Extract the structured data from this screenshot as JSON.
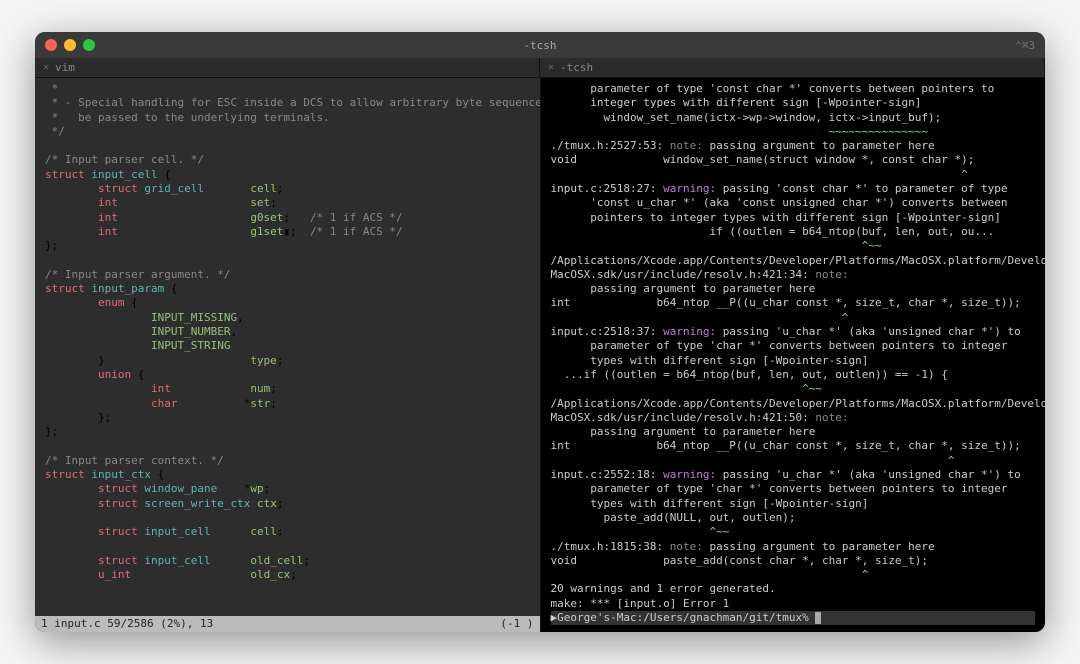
{
  "titlebar": {
    "title": "-tcsh",
    "rightBadge": "⌃⌘3"
  },
  "tabs": {
    "left": "vim",
    "right": "-tcsh"
  },
  "left": {
    "lines": [
      [
        {
          "cls": "c-comment",
          "t": " *"
        }
      ],
      [
        {
          "cls": "c-comment",
          "t": " * - Special handling for ESC inside a DCS to allow arbitrary byte sequences to"
        }
      ],
      [
        {
          "cls": "c-comment",
          "t": " *   be passed to the underlying terminals."
        }
      ],
      [
        {
          "cls": "c-comment",
          "t": " */"
        }
      ],
      [
        {
          "t": ""
        }
      ],
      [
        {
          "cls": "c-comment",
          "t": "/* Input parser cell. */"
        }
      ],
      [
        {
          "cls": "c-key",
          "t": "struct"
        },
        {
          "t": " "
        },
        {
          "cls": "c-ident",
          "t": "input_cell"
        },
        {
          "t": " {"
        }
      ],
      [
        {
          "t": "        "
        },
        {
          "cls": "c-key",
          "t": "struct"
        },
        {
          "t": " "
        },
        {
          "cls": "c-type",
          "t": "grid_cell"
        },
        {
          "t": "       "
        },
        {
          "cls": "c-field",
          "t": "cell"
        },
        {
          "t": ";"
        }
      ],
      [
        {
          "t": "        "
        },
        {
          "cls": "c-key",
          "t": "int"
        },
        {
          "t": "                    "
        },
        {
          "cls": "c-field",
          "t": "set"
        },
        {
          "t": ";"
        }
      ],
      [
        {
          "t": "        "
        },
        {
          "cls": "c-key",
          "t": "int"
        },
        {
          "t": "                    "
        },
        {
          "cls": "c-field",
          "t": "g0set"
        },
        {
          "t": ";   "
        },
        {
          "cls": "c-comment",
          "t": "/* 1 if ACS */"
        }
      ],
      [
        {
          "t": "        "
        },
        {
          "cls": "c-key",
          "t": "int"
        },
        {
          "t": "                    "
        },
        {
          "cls": "c-field",
          "t": "g1set"
        },
        {
          "t": "▮;  "
        },
        {
          "cls": "c-comment",
          "t": "/* 1 if ACS */"
        }
      ],
      [
        {
          "t": "};"
        }
      ],
      [
        {
          "t": ""
        }
      ],
      [
        {
          "cls": "c-comment",
          "t": "/* Input parser argument. */"
        }
      ],
      [
        {
          "cls": "c-key",
          "t": "struct"
        },
        {
          "t": " "
        },
        {
          "cls": "c-ident",
          "t": "input_param"
        },
        {
          "t": " {"
        }
      ],
      [
        {
          "t": "        "
        },
        {
          "cls": "c-key",
          "t": "enum"
        },
        {
          "t": " {"
        }
      ],
      [
        {
          "t": "                "
        },
        {
          "cls": "c-field",
          "t": "INPUT_MISSING"
        },
        {
          "t": ","
        }
      ],
      [
        {
          "t": "                "
        },
        {
          "cls": "c-field",
          "t": "INPUT_NUMBER"
        },
        {
          "t": ","
        }
      ],
      [
        {
          "t": "                "
        },
        {
          "cls": "c-field",
          "t": "INPUT_STRING"
        }
      ],
      [
        {
          "t": "        }                      "
        },
        {
          "cls": "c-field",
          "t": "type"
        },
        {
          "t": ";"
        }
      ],
      [
        {
          "t": "        "
        },
        {
          "cls": "c-key",
          "t": "union"
        },
        {
          "t": " {"
        }
      ],
      [
        {
          "t": "                "
        },
        {
          "cls": "c-key",
          "t": "int"
        },
        {
          "t": "            "
        },
        {
          "cls": "c-field",
          "t": "num"
        },
        {
          "t": ";"
        }
      ],
      [
        {
          "t": "                "
        },
        {
          "cls": "c-key",
          "t": "char"
        },
        {
          "t": "          *"
        },
        {
          "cls": "c-field",
          "t": "str"
        },
        {
          "t": ";"
        }
      ],
      [
        {
          "t": "        };"
        }
      ],
      [
        {
          "t": "};"
        }
      ],
      [
        {
          "t": ""
        }
      ],
      [
        {
          "cls": "c-comment",
          "t": "/* Input parser context. */"
        }
      ],
      [
        {
          "cls": "c-key",
          "t": "struct"
        },
        {
          "t": " "
        },
        {
          "cls": "c-ident",
          "t": "input_ctx"
        },
        {
          "t": " {"
        }
      ],
      [
        {
          "t": "        "
        },
        {
          "cls": "c-key",
          "t": "struct"
        },
        {
          "t": " "
        },
        {
          "cls": "c-type",
          "t": "window_pane"
        },
        {
          "t": "    *"
        },
        {
          "cls": "c-field",
          "t": "wp"
        },
        {
          "t": ";"
        }
      ],
      [
        {
          "t": "        "
        },
        {
          "cls": "c-key",
          "t": "struct"
        },
        {
          "t": " "
        },
        {
          "cls": "c-type",
          "t": "screen_write_ctx"
        },
        {
          "t": " "
        },
        {
          "cls": "c-field",
          "t": "ctx"
        },
        {
          "t": ";"
        }
      ],
      [
        {
          "t": ""
        }
      ],
      [
        {
          "t": "        "
        },
        {
          "cls": "c-key",
          "t": "struct"
        },
        {
          "t": " "
        },
        {
          "cls": "c-type",
          "t": "input_cell"
        },
        {
          "t": "      "
        },
        {
          "cls": "c-field",
          "t": "cell"
        },
        {
          "t": ";"
        }
      ],
      [
        {
          "t": ""
        }
      ],
      [
        {
          "t": "        "
        },
        {
          "cls": "c-key",
          "t": "struct"
        },
        {
          "t": " "
        },
        {
          "cls": "c-type",
          "t": "input_cell"
        },
        {
          "t": "      "
        },
        {
          "cls": "c-field",
          "t": "old_cell"
        },
        {
          "t": ";"
        }
      ],
      [
        {
          "t": "        "
        },
        {
          "cls": "c-key",
          "t": "u_int"
        },
        {
          "t": "                  "
        },
        {
          "cls": "c-field",
          "t": "old_cx"
        },
        {
          "t": ";"
        }
      ]
    ],
    "status": {
      "left": "1 input.c             59/2586 (2%), 13",
      "right": "(-1 )"
    }
  },
  "right": {
    "lines": [
      [
        {
          "cls": "c-white",
          "t": "      parameter of type 'const char *' converts between pointers to"
        }
      ],
      [
        {
          "cls": "c-white",
          "t": "      integer types with different sign [-Wpointer-sign]"
        }
      ],
      [
        {
          "cls": "c-white",
          "t": "        window_set_name(ictx->wp->window, ictx->input_buf);"
        }
      ],
      [
        {
          "cls": "c-green",
          "t": "                                          ~~~~~~~~~~~~~~~"
        }
      ],
      [
        {
          "cls": "c-white",
          "t": "./tmux.h:2527:53: "
        },
        {
          "cls": "c-note",
          "t": "note: "
        },
        {
          "cls": "c-white",
          "t": "passing argument to parameter here"
        }
      ],
      [
        {
          "cls": "c-white",
          "t": "void             window_set_name(struct window *, const char *);"
        }
      ],
      [
        {
          "cls": "c-green",
          "t": "                                                              ^"
        }
      ],
      [
        {
          "cls": "c-white",
          "t": "input.c:2518:27: "
        },
        {
          "cls": "c-warn",
          "t": "warning: "
        },
        {
          "cls": "c-white",
          "t": "passing 'const char *' to parameter of type"
        }
      ],
      [
        {
          "cls": "c-white",
          "t": "      'const u_char *' (aka 'const unsigned char *') converts between"
        }
      ],
      [
        {
          "cls": "c-white",
          "t": "      pointers to integer types with different sign [-Wpointer-sign]"
        }
      ],
      [
        {
          "cls": "c-white",
          "t": "                        if ((outlen = b64_ntop(buf, len, out, ou..."
        }
      ],
      [
        {
          "cls": "c-green",
          "t": "                                               ^~~"
        }
      ],
      [
        {
          "cls": "c-white",
          "t": "/Applications/Xcode.app/Contents/Developer/Platforms/MacOSX.platform/Developer/SDKs/"
        }
      ],
      [
        {
          "cls": "c-white",
          "t": "MacOSX.sdk/usr/include/resolv.h:421:34: "
        },
        {
          "cls": "c-note",
          "t": "note:"
        }
      ],
      [
        {
          "cls": "c-white",
          "t": "      passing argument to parameter here"
        }
      ],
      [
        {
          "cls": "c-white",
          "t": "int             b64_ntop __P((u_char const *, size_t, char *, size_t));"
        }
      ],
      [
        {
          "cls": "c-green",
          "t": "                                            ^"
        }
      ],
      [
        {
          "cls": "c-white",
          "t": "input.c:2518:37: "
        },
        {
          "cls": "c-warn",
          "t": "warning: "
        },
        {
          "cls": "c-white",
          "t": "passing 'u_char *' (aka 'unsigned char *') to"
        }
      ],
      [
        {
          "cls": "c-white",
          "t": "      parameter of type 'char *' converts between pointers to integer"
        }
      ],
      [
        {
          "cls": "c-white",
          "t": "      types with different sign [-Wpointer-sign]"
        }
      ],
      [
        {
          "cls": "c-white",
          "t": "  ...if ((outlen = b64_ntop(buf, len, out, outlen)) == -1) {"
        }
      ],
      [
        {
          "cls": "c-green",
          "t": "                                      ^~~"
        }
      ],
      [
        {
          "cls": "c-white",
          "t": "/Applications/Xcode.app/Contents/Developer/Platforms/MacOSX.platform/Developer/SDKs/"
        }
      ],
      [
        {
          "cls": "c-white",
          "t": "MacOSX.sdk/usr/include/resolv.h:421:50: "
        },
        {
          "cls": "c-note",
          "t": "note:"
        }
      ],
      [
        {
          "cls": "c-white",
          "t": "      passing argument to parameter here"
        }
      ],
      [
        {
          "cls": "c-white",
          "t": "int             b64_ntop __P((u_char const *, size_t, char *, size_t));"
        }
      ],
      [
        {
          "cls": "c-green",
          "t": "                                                            ^"
        }
      ],
      [
        {
          "cls": "c-white",
          "t": "input.c:2552:18: "
        },
        {
          "cls": "c-warn",
          "t": "warning: "
        },
        {
          "cls": "c-white",
          "t": "passing 'u_char *' (aka 'unsigned char *') to"
        }
      ],
      [
        {
          "cls": "c-white",
          "t": "      parameter of type 'char *' converts between pointers to integer"
        }
      ],
      [
        {
          "cls": "c-white",
          "t": "      types with different sign [-Wpointer-sign]"
        }
      ],
      [
        {
          "cls": "c-white",
          "t": "        paste_add(NULL, out, outlen);"
        }
      ],
      [
        {
          "cls": "c-green",
          "t": "                        ^~~"
        }
      ],
      [
        {
          "cls": "c-white",
          "t": "./tmux.h:1815:38: "
        },
        {
          "cls": "c-note",
          "t": "note: "
        },
        {
          "cls": "c-white",
          "t": "passing argument to parameter here"
        }
      ],
      [
        {
          "cls": "c-white",
          "t": "void             paste_add(const char *, char *, size_t);"
        }
      ],
      [
        {
          "cls": "c-green",
          "t": "                                               ^"
        }
      ],
      [
        {
          "cls": "c-white",
          "t": "20 warnings and 1 error generated."
        }
      ],
      [
        {
          "cls": "c-white",
          "t": "make: *** [input.o] Error 1"
        }
      ]
    ],
    "prompt": "▶George's-Mac:/Users/gnachman/git/tmux% "
  }
}
